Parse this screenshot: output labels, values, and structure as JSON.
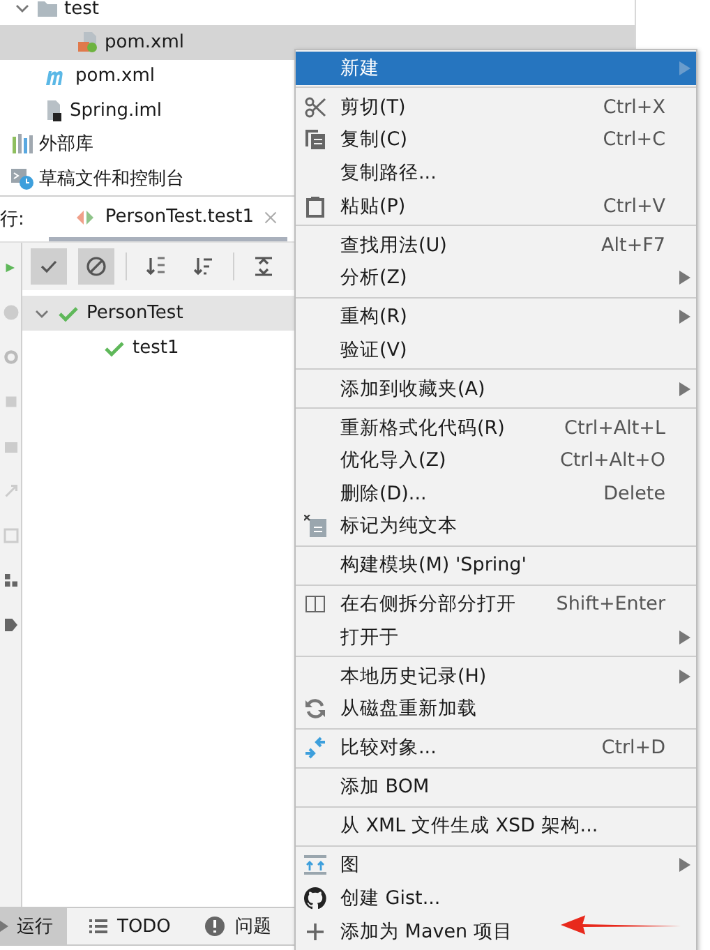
{
  "project_tree": {
    "module_contents": [
      {
        "label": "test",
        "kind": "folder",
        "expanded": true,
        "selected": false,
        "children": [
          {
            "label": "pom.xml",
            "kind": "spring-xml",
            "selected": true
          }
        ]
      },
      {
        "label": "pom.xml",
        "kind": "maven",
        "selected": false
      },
      {
        "label": "Spring.iml",
        "kind": "iml",
        "selected": false
      }
    ],
    "top_items": [
      {
        "label": "外部库",
        "kind": "library",
        "selected": false
      },
      {
        "label": "草稿文件和控制台",
        "kind": "scratch",
        "selected": false
      }
    ]
  },
  "run_panel": {
    "label": "行:",
    "tab": {
      "title": "PersonTest.test1",
      "selected": true
    },
    "toolbar": [
      {
        "kind": "check",
        "pressed": true
      },
      {
        "kind": "stop",
        "pressed": true
      },
      {
        "kind": "sort-alpha",
        "pressed": false
      },
      {
        "kind": "sort-duration",
        "pressed": false
      },
      {
        "kind": "expand",
        "pressed": false
      }
    ],
    "tests": [
      {
        "label": "PersonTest",
        "passed": true,
        "expanded": true,
        "selected": true,
        "children": [
          {
            "label": "test1",
            "passed": true,
            "selected": false
          }
        ]
      }
    ]
  },
  "bottom_tabs": [
    {
      "label": "运行",
      "kind": "run",
      "selected": true
    },
    {
      "label": "TODO",
      "kind": "list",
      "selected": false
    },
    {
      "label": "问题",
      "kind": "alert",
      "selected": false
    }
  ],
  "context_menu": {
    "groups": [
      {
        "items": [
          {
            "label": "新建",
            "selected": true,
            "submenu": true
          }
        ]
      },
      {
        "items": [
          {
            "label": "剪切(T)",
            "shortcut": "Ctrl+X",
            "kind": "scissors",
            "selected": false,
            "submenu": false
          },
          {
            "label": "复制(C)",
            "shortcut": "Ctrl+C",
            "kind": "copy",
            "selected": false,
            "submenu": false
          },
          {
            "label": "复制路径...",
            "selected": false,
            "submenu": false
          },
          {
            "label": "粘贴(P)",
            "shortcut": "Ctrl+V",
            "kind": "paste",
            "selected": false,
            "submenu": false
          }
        ]
      },
      {
        "items": [
          {
            "label": "查找用法(U)",
            "shortcut": "Alt+F7",
            "selected": false,
            "submenu": false
          },
          {
            "label": "分析(Z)",
            "selected": false,
            "submenu": true
          }
        ]
      },
      {
        "items": [
          {
            "label": "重构(R)",
            "selected": false,
            "submenu": true
          },
          {
            "label": "验证(V)",
            "selected": false,
            "submenu": false
          }
        ]
      },
      {
        "items": [
          {
            "label": "添加到收藏夹(A)",
            "selected": false,
            "submenu": true
          }
        ]
      },
      {
        "items": [
          {
            "label": "重新格式化代码(R)",
            "shortcut": "Ctrl+Alt+L",
            "selected": false,
            "submenu": false
          },
          {
            "label": "优化导入(Z)",
            "shortcut": "Ctrl+Alt+O",
            "selected": false,
            "submenu": false
          },
          {
            "label": "删除(D)...",
            "shortcut": "Delete",
            "selected": false,
            "submenu": false
          },
          {
            "label": "标记为纯文本",
            "kind": "plain-text",
            "selected": false,
            "submenu": false
          }
        ]
      },
      {
        "items": [
          {
            "label": "构建模块(M) 'Spring'",
            "selected": false,
            "submenu": false
          }
        ]
      },
      {
        "items": [
          {
            "label": "在右侧拆分部分打开",
            "shortcut": "Shift+Enter",
            "kind": "split",
            "selected": false,
            "submenu": false
          },
          {
            "label": "打开于",
            "selected": false,
            "submenu": true
          }
        ]
      },
      {
        "items": [
          {
            "label": "本地历史记录(H)",
            "selected": false,
            "submenu": true
          },
          {
            "label": "从磁盘重新加载",
            "kind": "reload",
            "selected": false,
            "submenu": false
          }
        ]
      },
      {
        "items": [
          {
            "label": "比较对象...",
            "shortcut": "Ctrl+D",
            "kind": "compare",
            "selected": false,
            "submenu": false
          }
        ]
      },
      {
        "items": [
          {
            "label": "添加 BOM",
            "selected": false,
            "submenu": false
          }
        ]
      },
      {
        "items": [
          {
            "label": "从 XML 文件生成 XSD 架构...",
            "selected": false,
            "submenu": false
          }
        ]
      },
      {
        "items": [
          {
            "label": "图",
            "kind": "diagram",
            "selected": false,
            "submenu": true
          },
          {
            "label": "创建 Gist...",
            "kind": "github",
            "selected": false,
            "submenu": false
          },
          {
            "label": "添加为 Maven 项目",
            "kind": "plus",
            "selected": false,
            "submenu": false
          }
        ]
      }
    ]
  }
}
